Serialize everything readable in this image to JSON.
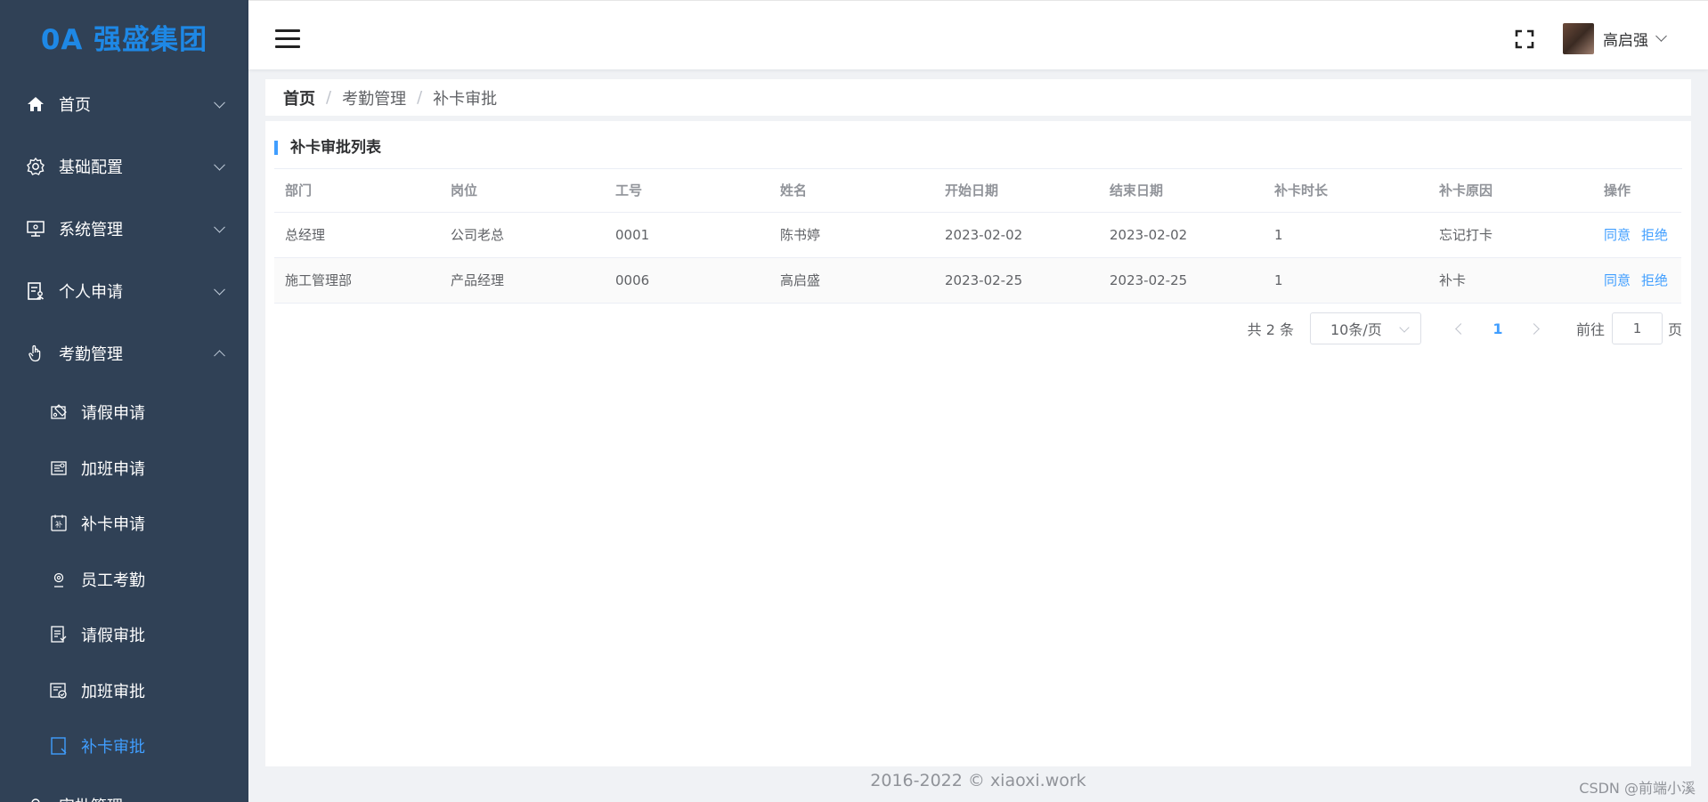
{
  "brand": {
    "logo": "0A 强盛集团"
  },
  "sidebar": {
    "items": [
      {
        "label": "首页",
        "icon": "home-icon"
      },
      {
        "label": "基础配置",
        "icon": "gear-icon"
      },
      {
        "label": "系统管理",
        "icon": "monitor-icon"
      },
      {
        "label": "个人申请",
        "icon": "document-user-icon"
      },
      {
        "label": "考勤管理",
        "icon": "hand-icon",
        "expanded": true
      },
      {
        "label": "审批管理",
        "icon": "user-icon"
      }
    ],
    "sub_items": [
      {
        "label": "请假申请",
        "icon": "leave-icon"
      },
      {
        "label": "加班申请",
        "icon": "overtime-icon"
      },
      {
        "label": "补卡申请",
        "icon": "card-patch-icon"
      },
      {
        "label": "员工考勤",
        "icon": "attendance-icon"
      },
      {
        "label": "请假审批",
        "icon": "leave-approval-icon"
      },
      {
        "label": "加班审批",
        "icon": "overtime-approval-icon"
      },
      {
        "label": "补卡审批",
        "icon": "card-approval-icon",
        "active": true
      }
    ]
  },
  "header": {
    "user_name": "高启强"
  },
  "breadcrumb": {
    "home": "首页",
    "level1": "考勤管理",
    "level2": "补卡审批",
    "separator": "/"
  },
  "card": {
    "title": "补卡审批列表"
  },
  "table": {
    "columns": [
      "部门",
      "岗位",
      "工号",
      "姓名",
      "开始日期",
      "结束日期",
      "补卡时长",
      "补卡原因",
      "操作"
    ],
    "rows": [
      {
        "dept": "总经理",
        "post": "公司老总",
        "id": "0001",
        "name": "陈书婷",
        "start": "2023-02-02",
        "end": "2023-02-02",
        "duration": "1",
        "reason": "忘记打卡"
      },
      {
        "dept": "施工管理部",
        "post": "产品经理",
        "id": "0006",
        "name": "高启盛",
        "start": "2023-02-25",
        "end": "2023-02-25",
        "duration": "1",
        "reason": "补卡"
      }
    ],
    "actions": {
      "approve": "同意",
      "reject": "拒绝"
    }
  },
  "pagination": {
    "total": "共 2 条",
    "page_size": "10条/页",
    "current": "1",
    "goto_prefix": "前往",
    "goto_value": "1",
    "goto_suffix": "页"
  },
  "footer": {
    "copyright": "2016-2022 © xiaoxi.work",
    "watermark": "CSDN @前端小溪"
  },
  "colors": {
    "sidebar_bg": "#304156",
    "accent": "#409eff",
    "logo": "#1e88e5"
  }
}
